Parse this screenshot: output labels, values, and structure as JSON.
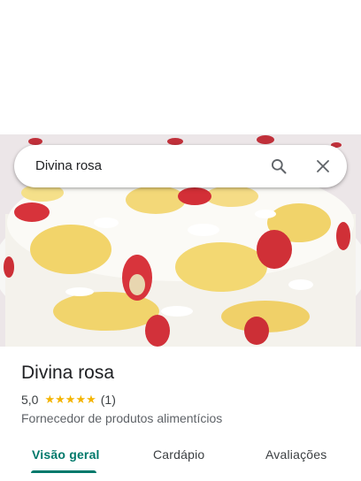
{
  "search": {
    "query": "Divina rosa"
  },
  "place": {
    "name": "Divina rosa",
    "rating": "5,0",
    "stars": 5,
    "review_count": "(1)",
    "category": "Fornecedor de produtos alimentícios"
  },
  "tabs": [
    {
      "label": "Visão geral",
      "active": true
    },
    {
      "label": "Cardápio",
      "active": false
    },
    {
      "label": "Avaliações",
      "active": false
    }
  ],
  "colors": {
    "accent": "#00796b",
    "star": "#f4b400"
  },
  "icons": {
    "search": "search-icon",
    "close": "close-icon",
    "star": "star-icon"
  }
}
